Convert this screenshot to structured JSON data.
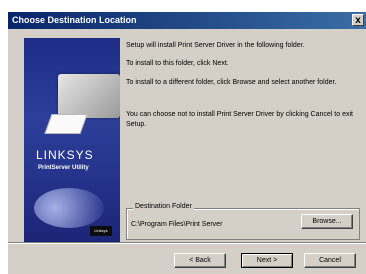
{
  "window": {
    "title": "Choose Destination Location",
    "close_glyph": "x"
  },
  "banner": {
    "brand": "LINKSYS",
    "tagline": "PrintServer Utility",
    "badge": "Linksys"
  },
  "body": {
    "line1": "Setup will install Print Server Driver in the following folder.",
    "line2": "To install to this folder, click Next.",
    "line3": "To install to a different folder, click Browse and select another folder.",
    "line4": "You can choose not to install Print Server Driver by clicking Cancel to exit Setup."
  },
  "destination": {
    "group_label": "Destination Folder",
    "path": "C:\\Program Files\\Print Server",
    "browse_label": "Browse..."
  },
  "buttons": {
    "back": "< Back",
    "next": "Next >",
    "cancel": "Cancel"
  }
}
